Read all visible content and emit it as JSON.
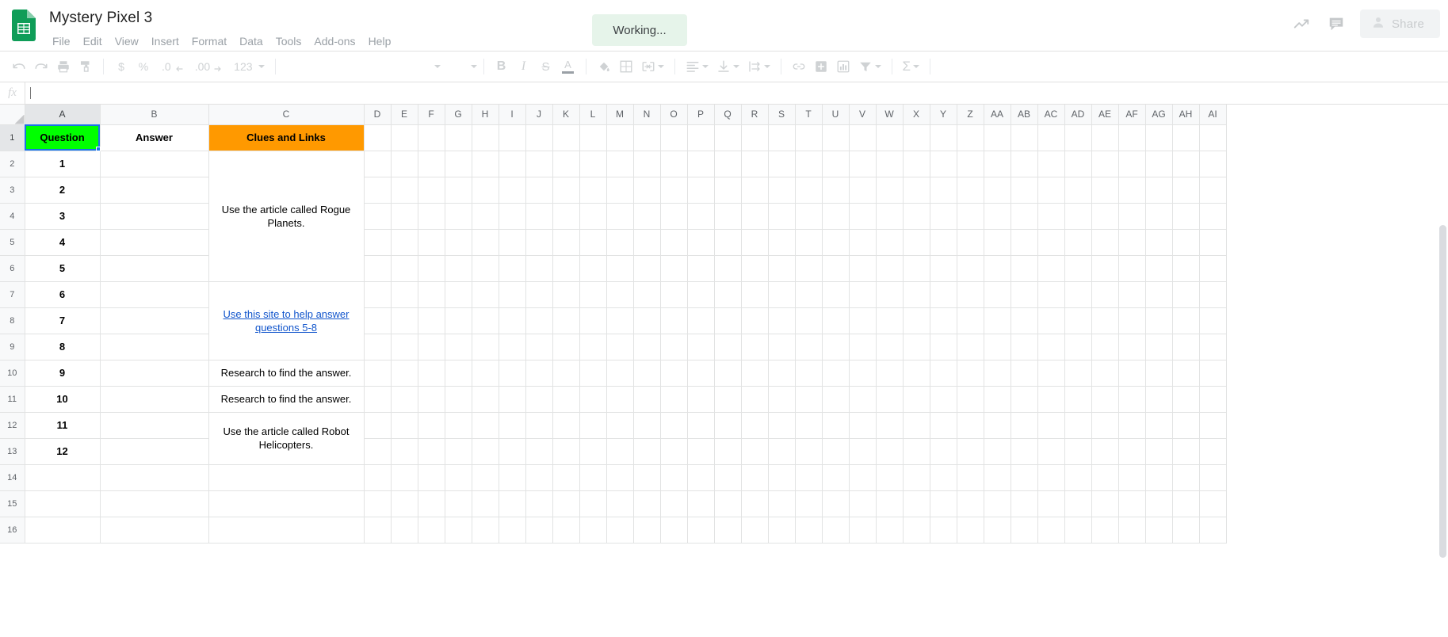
{
  "app": {
    "doc_title": "Mystery Pixel 3",
    "logo_icon": "sheets-logo-icon",
    "menus": [
      "File",
      "Edit",
      "View",
      "Insert",
      "Format",
      "Data",
      "Tools",
      "Add-ons",
      "Help"
    ],
    "toast": "Working...",
    "share_label": "Share",
    "activity_icon": "activity-trend-icon",
    "comment_icon": "comment-icon",
    "share_person_icon": "person-icon"
  },
  "toolbar": {
    "items": [
      {
        "name": "undo",
        "icon": "undo-icon"
      },
      {
        "name": "redo",
        "icon": "redo-icon"
      },
      {
        "name": "print",
        "icon": "print-icon"
      },
      {
        "name": "paint-format",
        "icon": "paint-format-icon"
      },
      {
        "name": "currency",
        "icon": "dollar-icon",
        "text": "$"
      },
      {
        "name": "percent",
        "icon": "percent-icon",
        "text": "%"
      },
      {
        "name": "decrease-decimal",
        "icon": "decrease-decimal-icon",
        "text": ".0"
      },
      {
        "name": "increase-decimal",
        "icon": "increase-decimal-icon",
        "text": ".00"
      },
      {
        "name": "more-formats",
        "icon": "number-formats-icon",
        "text": "123"
      },
      {
        "name": "font-family",
        "icon": "font-dropdown-icon"
      },
      {
        "name": "font-size",
        "icon": "font-size-dropdown-icon"
      },
      {
        "name": "bold",
        "icon": "bold-icon",
        "text": "B"
      },
      {
        "name": "italic",
        "icon": "italic-icon",
        "text": "I"
      },
      {
        "name": "strikethrough",
        "icon": "strikethrough-icon",
        "text": "S"
      },
      {
        "name": "text-color",
        "icon": "text-color-icon",
        "text": "A"
      },
      {
        "name": "fill-color",
        "icon": "fill-color-icon"
      },
      {
        "name": "borders",
        "icon": "borders-icon"
      },
      {
        "name": "merge-cells",
        "icon": "merge-cells-icon"
      },
      {
        "name": "horizontal-align",
        "icon": "horizontal-align-icon"
      },
      {
        "name": "vertical-align",
        "icon": "vertical-align-icon"
      },
      {
        "name": "text-wrapping",
        "icon": "text-wrap-icon"
      },
      {
        "name": "insert-link",
        "icon": "link-icon"
      },
      {
        "name": "insert-comment",
        "icon": "add-comment-icon"
      },
      {
        "name": "insert-chart",
        "icon": "chart-icon"
      },
      {
        "name": "filter",
        "icon": "filter-icon"
      },
      {
        "name": "functions",
        "icon": "sigma-icon"
      }
    ]
  },
  "formula_bar": {
    "fx_label": "fx",
    "value": ""
  },
  "grid": {
    "columns": [
      "A",
      "B",
      "C",
      "D",
      "E",
      "F",
      "G",
      "H",
      "I",
      "J",
      "K",
      "L",
      "M",
      "N",
      "O",
      "P",
      "Q",
      "R",
      "S",
      "T",
      "U",
      "V",
      "W",
      "X",
      "Y",
      "Z",
      "AA",
      "AB",
      "AC",
      "AD",
      "AE",
      "AF",
      "AG",
      "AH",
      "AI"
    ],
    "selected_cell": "A1",
    "rows": [
      "1",
      "2",
      "3",
      "4",
      "5",
      "6",
      "7",
      "8",
      "9",
      "10",
      "11",
      "12",
      "13",
      "14",
      "15",
      "16"
    ],
    "headers": {
      "a1": "Question",
      "b1": "Answer",
      "c1": "Clues and Links"
    },
    "colors": {
      "a1_fill": "#00ff00",
      "c1_fill": "#ff9900",
      "selection": "#1a73e8",
      "link": "#1155cc"
    },
    "question_numbers": [
      "1",
      "2",
      "3",
      "4",
      "5",
      "6",
      "7",
      "8",
      "9",
      "10",
      "11",
      "12"
    ],
    "clues": [
      {
        "row_start": 2,
        "row_end": 6,
        "text": "Use the article called Rogue Planets.",
        "is_link": false
      },
      {
        "row_start": 7,
        "row_end": 9,
        "text": "Use this site to help answer questions 5-8",
        "is_link": true
      },
      {
        "row_start": 10,
        "row_end": 10,
        "text": "Research to find the answer.",
        "is_link": false
      },
      {
        "row_start": 11,
        "row_end": 11,
        "text": "Research to find the answer.",
        "is_link": false
      },
      {
        "row_start": 12,
        "row_end": 13,
        "text": "Use the article called Robot Helicopters.",
        "is_link": false
      }
    ]
  }
}
